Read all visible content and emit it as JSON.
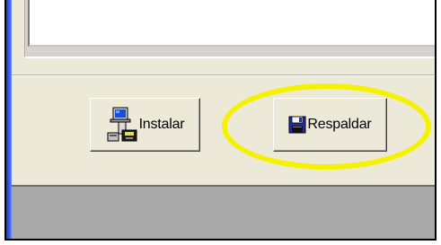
{
  "buttons": {
    "install": {
      "label": "Instalar",
      "icon": "computer-install-icon"
    },
    "backup": {
      "label": "Respaldar",
      "icon": "floppy-disk-icon"
    }
  },
  "colors": {
    "dialog_background": "#ece9d8",
    "window_frame_blue": "#2a4fd8",
    "highlight_ring": "#f5f200",
    "desktop_gray": "#a9a9a9"
  }
}
